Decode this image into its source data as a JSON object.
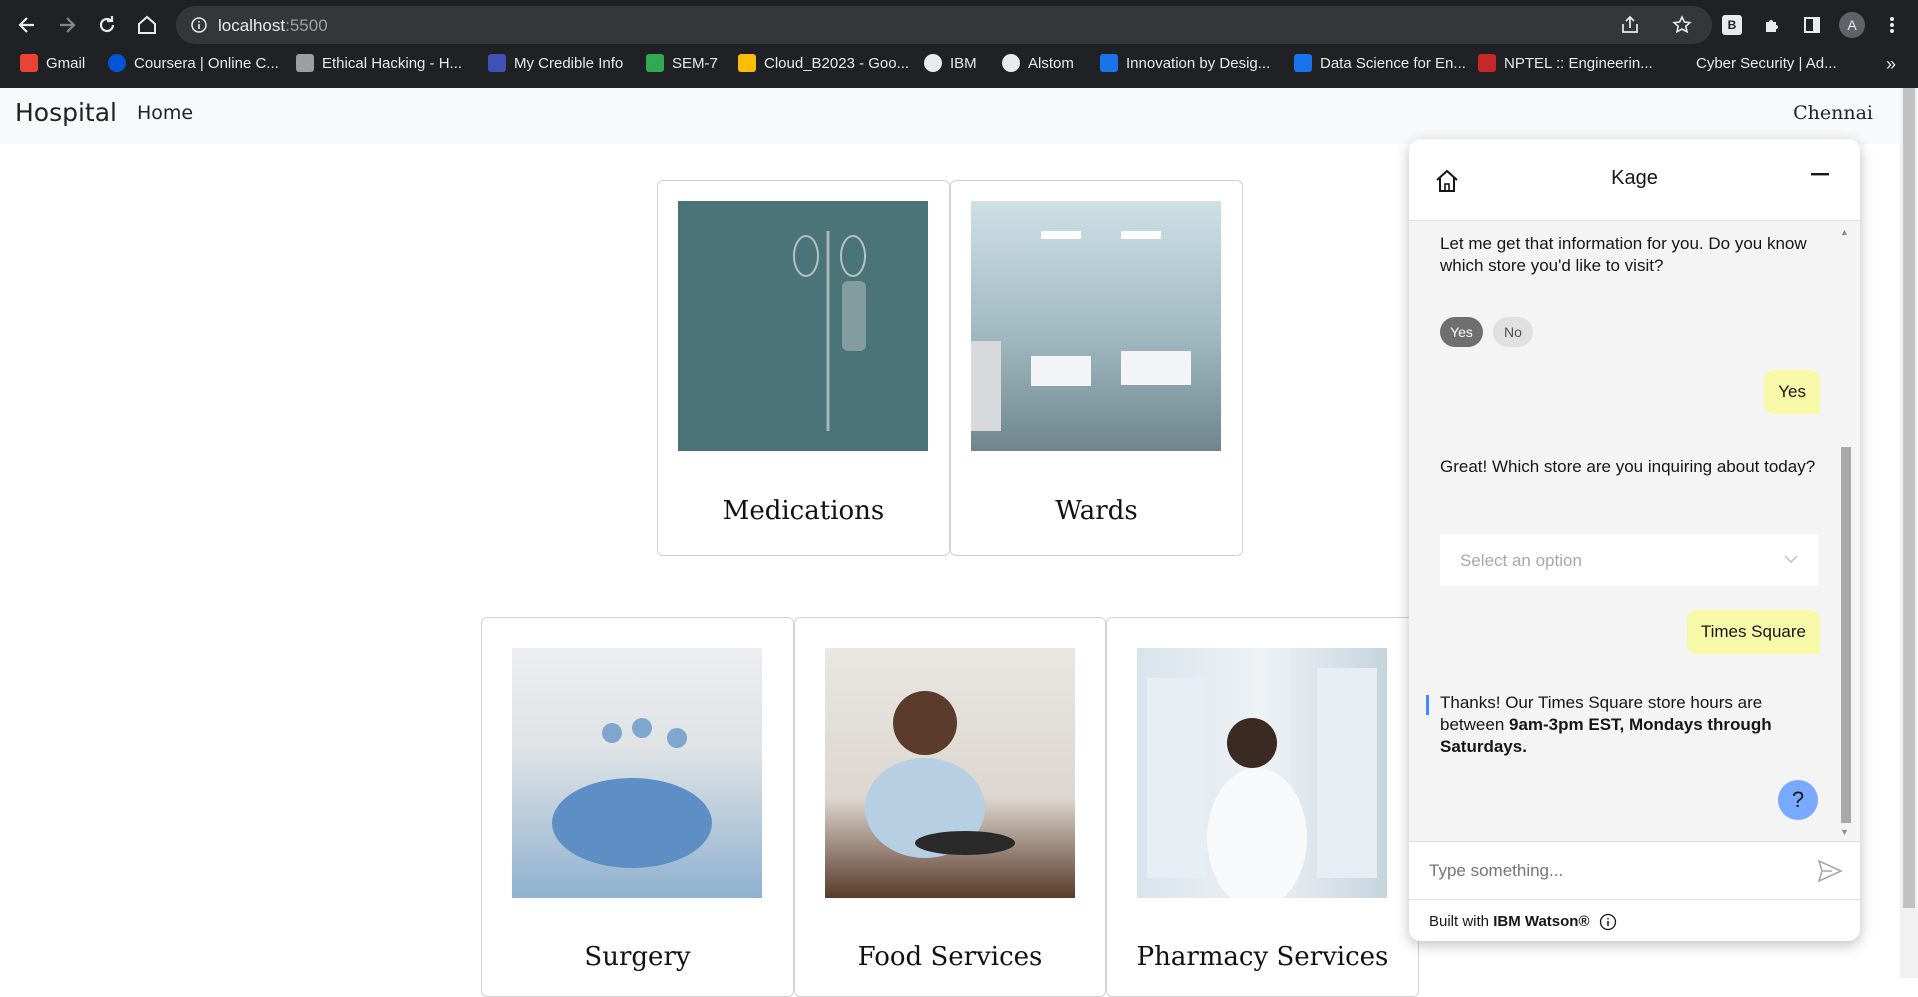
{
  "browser": {
    "url_host": "localhost",
    "url_port": ":5500",
    "profile_initial": "A",
    "bookmarks": [
      {
        "label": "Gmail",
        "color": "#ea4335"
      },
      {
        "label": "Coursera | Online C...",
        "color": "#0056d2"
      },
      {
        "label": "Ethical Hacking - H...",
        "color": "#9e9e9e"
      },
      {
        "label": "My Credible Info",
        "color": "#3f51b5"
      },
      {
        "label": "SEM-7",
        "color": "#34a853"
      },
      {
        "label": "Cloud_B2023 - Goo...",
        "color": "#fbbc04"
      },
      {
        "label": "IBM",
        "color": "#e8eaed"
      },
      {
        "label": "Alstom",
        "color": "#e8eaed"
      },
      {
        "label": "Innovation by Desig...",
        "color": "#1a73e8"
      },
      {
        "label": "Data Science for En...",
        "color": "#1a73e8"
      },
      {
        "label": "NPTEL :: Engineerin...",
        "color": "#c62828"
      },
      {
        "label": "Cyber Security | Ad...",
        "color": "#202124"
      }
    ]
  },
  "nav": {
    "brand": "Hospital",
    "home": "Home",
    "city": "Chennai"
  },
  "cards": [
    {
      "title": "Medications",
      "icon": "iv-drip-image"
    },
    {
      "title": "Wards",
      "icon": "hospital-ward-image"
    },
    {
      "title": "Surgery",
      "icon": "surgery-image"
    },
    {
      "title": "Food Services",
      "icon": "food-service-image"
    },
    {
      "title": "Pharmacy Services",
      "icon": "pharmacy-image"
    }
  ],
  "chat": {
    "title": "Kage",
    "msg1": "Let me get that information for you. Do you know which store you'd like to visit?",
    "option_yes": "Yes",
    "option_no": "No",
    "user1": "Yes",
    "msg2": "Great! Which store are you inquiring about today?",
    "select_placeholder": "Select an option",
    "user2": "Times Square",
    "msg3_prefix": "Thanks! Our Times Square store hours are between ",
    "msg3_bold": "9am-3pm EST, Mondays through Saturdays.",
    "help": "?",
    "input_placeholder": "Type something...",
    "footer_prefix": "Built with ",
    "footer_brand": "IBM Watson®",
    "accent": "#4589ff"
  }
}
